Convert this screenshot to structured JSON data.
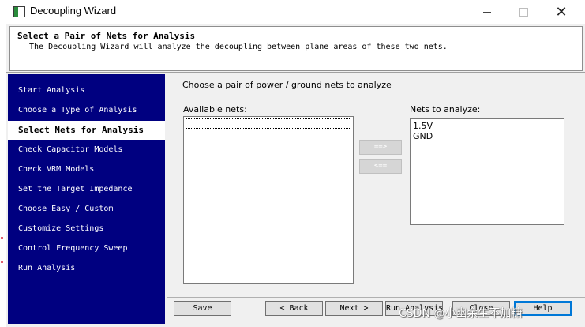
{
  "window": {
    "title": "Decoupling Wizard",
    "minimize_glyph": "—",
    "maximize_glyph": "☐",
    "close_glyph": "✕",
    "icon": "wizard-app-icon"
  },
  "header": {
    "title": "Select a Pair of Nets for Analysis",
    "description": "The Decoupling Wizard will analyze the decoupling between plane areas of these two nets."
  },
  "nav": {
    "items": [
      {
        "label": "Start Analysis",
        "active": false
      },
      {
        "label": "Choose a Type of Analysis",
        "active": false
      },
      {
        "label": "Select Nets for Analysis",
        "active": true
      },
      {
        "label": "Check Capacitor Models",
        "active": false
      },
      {
        "label": "Check VRM Models",
        "active": false
      },
      {
        "label": "Set the Target Impedance",
        "active": false
      },
      {
        "label": "Choose Easy / Custom",
        "active": false
      },
      {
        "label": "Customize Settings",
        "active": false
      },
      {
        "label": "Control Frequency Sweep",
        "active": false
      },
      {
        "label": "Run Analysis",
        "active": false
      }
    ]
  },
  "content": {
    "instruction": "Choose a pair of power / ground nets to analyze",
    "available_label": "Available nets:",
    "available_nets": [],
    "analyze_label": "Nets to analyze:",
    "analyze_nets": [
      "1.5V",
      "GND"
    ],
    "add_button": "==>",
    "remove_button": "<=="
  },
  "footer": {
    "save": "Save",
    "back": "< Back",
    "next": "Next >",
    "run": "Run Analysis",
    "close": "Close",
    "help": "Help"
  },
  "watermark": "CSDN @小幽余生不加糖",
  "colors": {
    "nav_bg": "#000080",
    "focus_border": "#0078d7"
  }
}
